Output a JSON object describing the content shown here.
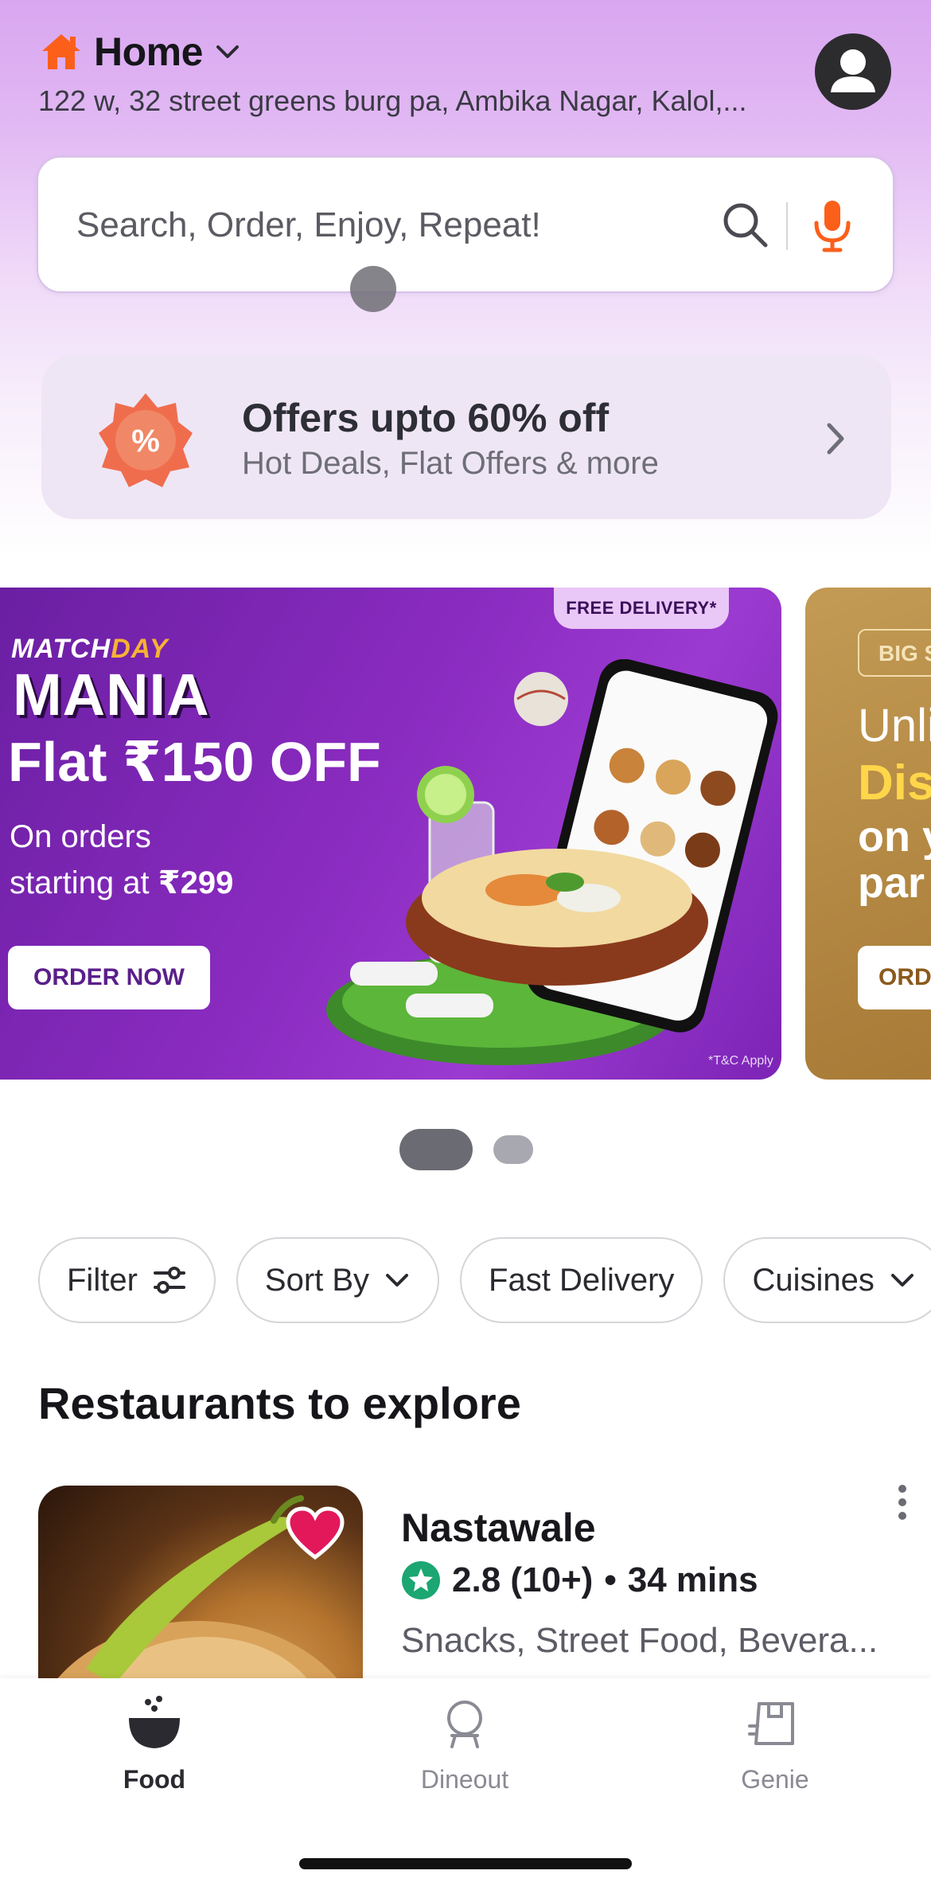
{
  "header": {
    "title": "Home",
    "address": "122 w, 32 street greens burg pa, Ambika Nagar, Kalol,..."
  },
  "search": {
    "placeholder": "Search, Order, Enjoy, Repeat!"
  },
  "offers": {
    "title": "Offers upto 60% off",
    "subtitle": "Hot Deals, Flat Offers & more",
    "badge_symbol": "%"
  },
  "banners": [
    {
      "tag": "FREE DELIVERY*",
      "brand_top": "MATCH",
      "brand_top_accent": "DAY",
      "brand": "MANIA",
      "headline": "Flat ₹150 OFF",
      "line1": "On orders",
      "line2_prefix": "starting at ",
      "line2_amount": "₹299",
      "cta": "ORDER NOW",
      "disclaimer": "*T&C Apply"
    },
    {
      "tag": "BIG S",
      "line1": "Unli",
      "line2": "Dis",
      "line3": "on y",
      "line4": "par",
      "cta": "ORD"
    }
  ],
  "carousel": {
    "active_index": 0,
    "count": 2
  },
  "filters": [
    {
      "label": "Filter",
      "icon": "sliders-icon"
    },
    {
      "label": "Sort By",
      "icon": "chevron-down-icon"
    },
    {
      "label": "Fast Delivery",
      "icon": ""
    },
    {
      "label": "Cuisines",
      "icon": "chevron-down-icon"
    }
  ],
  "section": {
    "title": "Restaurants to explore"
  },
  "restaurant": {
    "name": "Nastawale",
    "rating": "2.8 (10+)",
    "separator": "•",
    "time": "34 mins",
    "cuisines": "Snacks, Street Food, Bevera...",
    "favorite": true
  },
  "bottom_nav": [
    {
      "label": "Food",
      "icon": "bowl-icon",
      "active": true
    },
    {
      "label": "Dineout",
      "icon": "cloche-icon",
      "active": false
    },
    {
      "label": "Genie",
      "icon": "package-icon",
      "active": false
    }
  ],
  "colors": {
    "accent": "#fc5f1a",
    "offer_badge": "#ef6d4d",
    "rating_green": "#1ba672",
    "heart": "#e2185b",
    "banner_purple": "#8a2bc0"
  }
}
